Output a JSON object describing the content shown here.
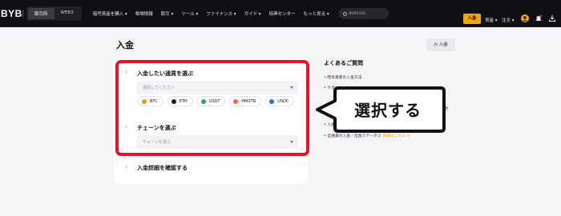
{
  "header": {
    "logo": "BYBIT",
    "mode_tabs": [
      "取引所",
      "WEB3"
    ],
    "nav": [
      "暗号資産を購入 ▾",
      "相場情報",
      "取引 ▾",
      "ツール ▾",
      "ファイナンス ▾",
      "ガイド ▾",
      "特典センター",
      "もっと見る ▾"
    ],
    "search_placeholder": "BXP0320",
    "deposit_label": "入金",
    "assets_label": "資産 ▾",
    "orders_label": "注文 ▾"
  },
  "page": {
    "title": "入金",
    "top_button": "入金"
  },
  "steps": [
    {
      "num": "1",
      "title": "入金したい通貨を選ぶ",
      "placeholder": "選択してください"
    },
    {
      "num": "2",
      "title": "チェーンを選ぶ",
      "placeholder": "チェーンを選ぶ"
    },
    {
      "num": "3",
      "title": "入金詳細を確認する"
    }
  ],
  "coins": [
    {
      "name": "BTC",
      "color": "#f7931a"
    },
    {
      "name": "ETH",
      "color": "#1d1d1f"
    },
    {
      "name": "USDT",
      "color": "#26a17b"
    },
    {
      "name": "HMSTR",
      "color": "#f26b2a"
    },
    {
      "name": "USDC",
      "color": "#2775ca"
    }
  ],
  "faq": {
    "title": "よくあるご質問",
    "items": [
      "暗号資産の入金方法",
      "サポート",
      "な場合",
      "入金",
      "全通貨の入金／出金ステータス"
    ],
    "detail_link": "詳細はこちら ➜"
  },
  "callout": {
    "text": "選択する"
  },
  "colors": {
    "accent": "#f7a600",
    "highlight": "#e8132a"
  }
}
